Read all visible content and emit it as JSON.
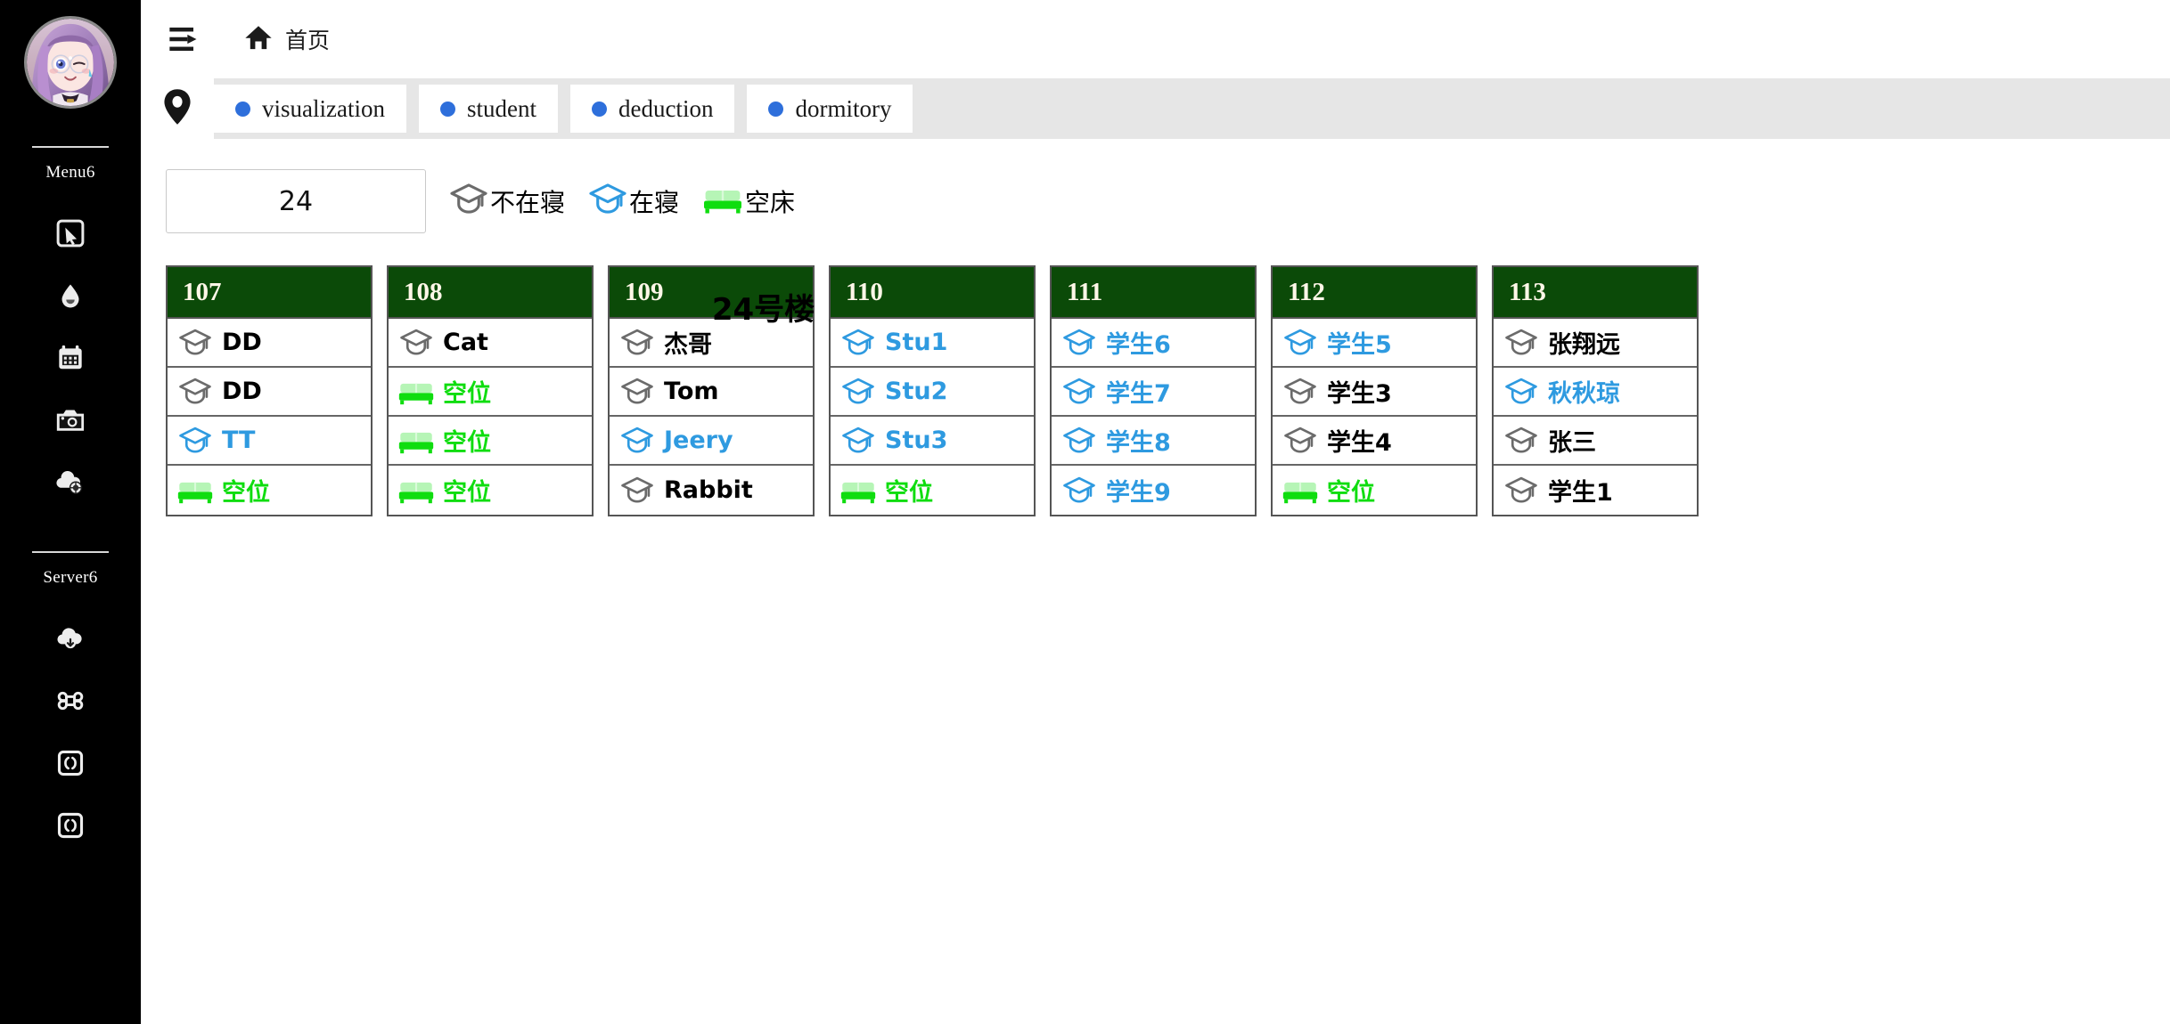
{
  "sidebar": {
    "avatar_name": "user-avatar",
    "menu_label": "Menu6",
    "server_label": "Server6",
    "menu_icons": [
      {
        "name": "cursor-click-icon",
        "glyph": "cursor"
      },
      {
        "name": "water-drop-icon",
        "glyph": "drop"
      },
      {
        "name": "calendar-icon",
        "glyph": "calendar"
      },
      {
        "name": "camera-icon",
        "glyph": "camera"
      },
      {
        "name": "cloud-settings-icon",
        "glyph": "cloud-gear"
      }
    ],
    "server_icons": [
      {
        "name": "cloud-download-icon",
        "glyph": "cloud-down"
      },
      {
        "name": "command-icon",
        "glyph": "command"
      },
      {
        "name": "code-brackets-icon",
        "glyph": "code"
      },
      {
        "name": "code-brackets-icon-2",
        "glyph": "code"
      }
    ]
  },
  "header": {
    "menu_toggle_name": "sidebar-toggle-icon",
    "home_icon_name": "home-icon",
    "breadcrumb": "首页"
  },
  "tabstrip": {
    "pin_icon_name": "location-pin-icon",
    "dot_color": "#2e6fdb",
    "tabs": [
      {
        "label": "visualization"
      },
      {
        "label": "student"
      },
      {
        "label": "deduction"
      },
      {
        "label": "dormitory"
      }
    ]
  },
  "toolbar": {
    "floor_value": "24",
    "floor_placeholder": "",
    "legend": [
      {
        "icon": "graduation-cap-icon-gray",
        "label": "不在寝",
        "color": "#6b6b6b"
      },
      {
        "icon": "graduation-cap-icon-blue",
        "label": "在寝",
        "color": "#2e9ae0"
      },
      {
        "icon": "bed-icon-green",
        "label": "空床",
        "color": "#0fdd0f"
      }
    ]
  },
  "building": {
    "title": "24号楼"
  },
  "rooms": [
    {
      "number": "107",
      "beds": [
        {
          "occupant": "DD",
          "status": "away"
        },
        {
          "occupant": "DD",
          "status": "away"
        },
        {
          "occupant": "TT",
          "status": "present"
        },
        {
          "occupant": "空位",
          "status": "empty"
        }
      ]
    },
    {
      "number": "108",
      "beds": [
        {
          "occupant": "Cat",
          "status": "away"
        },
        {
          "occupant": "空位",
          "status": "empty"
        },
        {
          "occupant": "空位",
          "status": "empty"
        },
        {
          "occupant": "空位",
          "status": "empty"
        }
      ]
    },
    {
      "number": "109",
      "beds": [
        {
          "occupant": "杰哥",
          "status": "away"
        },
        {
          "occupant": "Tom",
          "status": "away"
        },
        {
          "occupant": "Jeery",
          "status": "present"
        },
        {
          "occupant": "Rabbit",
          "status": "away"
        }
      ]
    },
    {
      "number": "110",
      "beds": [
        {
          "occupant": "Stu1",
          "status": "present"
        },
        {
          "occupant": "Stu2",
          "status": "present"
        },
        {
          "occupant": "Stu3",
          "status": "present"
        },
        {
          "occupant": "空位",
          "status": "empty"
        }
      ]
    },
    {
      "number": "111",
      "beds": [
        {
          "occupant": "学生6",
          "status": "present"
        },
        {
          "occupant": "学生7",
          "status": "present"
        },
        {
          "occupant": "学生8",
          "status": "present"
        },
        {
          "occupant": "学生9",
          "status": "present"
        }
      ]
    },
    {
      "number": "112",
      "beds": [
        {
          "occupant": "学生5",
          "status": "present"
        },
        {
          "occupant": "学生3",
          "status": "away"
        },
        {
          "occupant": "学生4",
          "status": "away"
        },
        {
          "occupant": "空位",
          "status": "empty"
        }
      ]
    },
    {
      "number": "113",
      "beds": [
        {
          "occupant": "张翔远",
          "status": "away"
        },
        {
          "occupant": "秋秋琼",
          "status": "present"
        },
        {
          "occupant": "张三",
          "status": "away"
        },
        {
          "occupant": "学生1",
          "status": "away"
        }
      ]
    }
  ],
  "colors": {
    "sidebar_bg": "#000000",
    "room_header_bg": "#0b4a08",
    "tab_strip_bg": "#e6e6e6",
    "present_blue": "#2e9ae0",
    "empty_green": "#0fdd0f",
    "away_black": "#000000"
  }
}
